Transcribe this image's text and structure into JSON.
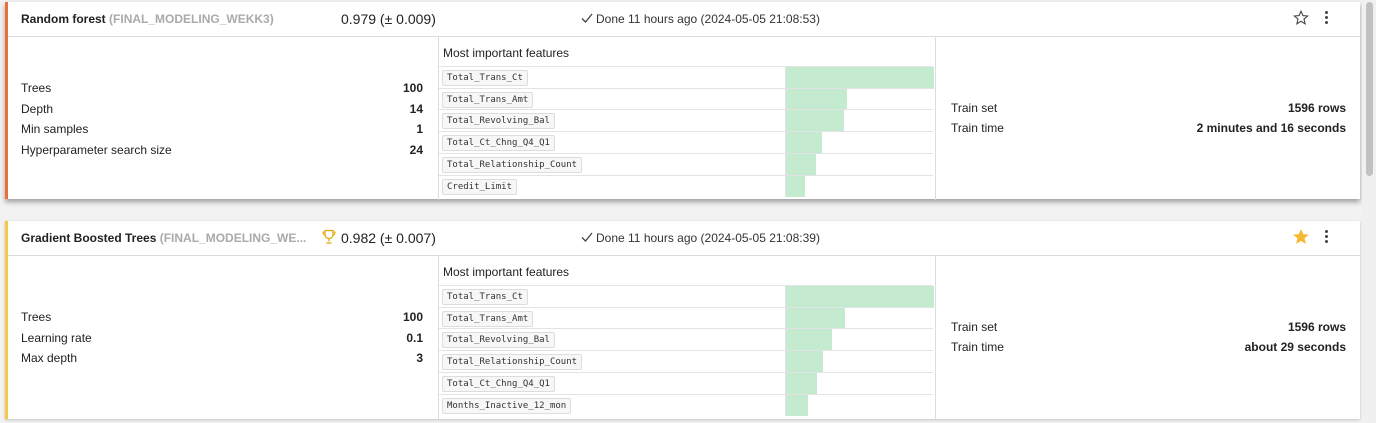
{
  "cards": [
    {
      "model_name": "Random forest",
      "project": "(FINAL_MODELING_WEKK3)",
      "score": "0.979 (± 0.009)",
      "best": false,
      "status": "Done 11 hours ago (2024-05-05 21:08:53)",
      "starred": false,
      "accent_color": "#e8713b",
      "params": [
        {
          "label": "Trees",
          "value": "100"
        },
        {
          "label": "Depth",
          "value": "14"
        },
        {
          "label": "Min samples",
          "value": "1"
        },
        {
          "label": "Hyperparameter search size",
          "value": "24"
        }
      ],
      "features_title": "Most important features",
      "features": [
        {
          "name": "Total_Trans_Ct",
          "importance": 1.0
        },
        {
          "name": "Total_Trans_Amt",
          "importance": 0.41
        },
        {
          "name": "Total_Revolving_Bal",
          "importance": 0.39
        },
        {
          "name": "Total_Ct_Chng_Q4_Q1",
          "importance": 0.24
        },
        {
          "name": "Total_Relationship_Count",
          "importance": 0.2
        },
        {
          "name": "Credit_Limit",
          "importance": 0.13
        }
      ],
      "train": [
        {
          "label": "Train set",
          "value": "1596 rows"
        },
        {
          "label": "Train time",
          "value": "2 minutes and 16 seconds"
        }
      ]
    },
    {
      "model_name": "Gradient Boosted Trees",
      "project": "(FINAL_MODELING_WE...",
      "score": "0.982 (± 0.007)",
      "best": true,
      "status": "Done 11 hours ago (2024-05-05 21:08:39)",
      "starred": true,
      "accent_color": "#f5c84b",
      "params": [
        {
          "label": "Trees",
          "value": "100"
        },
        {
          "label": "Learning rate",
          "value": "0.1"
        },
        {
          "label": "Max depth",
          "value": "3"
        }
      ],
      "features_title": "Most important features",
      "features": [
        {
          "name": "Total_Trans_Ct",
          "importance": 1.0
        },
        {
          "name": "Total_Trans_Amt",
          "importance": 0.4
        },
        {
          "name": "Total_Revolving_Bal",
          "importance": 0.31
        },
        {
          "name": "Total_Relationship_Count",
          "importance": 0.25
        },
        {
          "name": "Total_Ct_Chng_Q4_Q1",
          "importance": 0.21
        },
        {
          "name": "Months_Inactive_12_mon",
          "importance": 0.15
        }
      ],
      "train": [
        {
          "label": "Train set",
          "value": "1596 rows"
        },
        {
          "label": "Train time",
          "value": "about 29 seconds"
        }
      ]
    }
  ]
}
